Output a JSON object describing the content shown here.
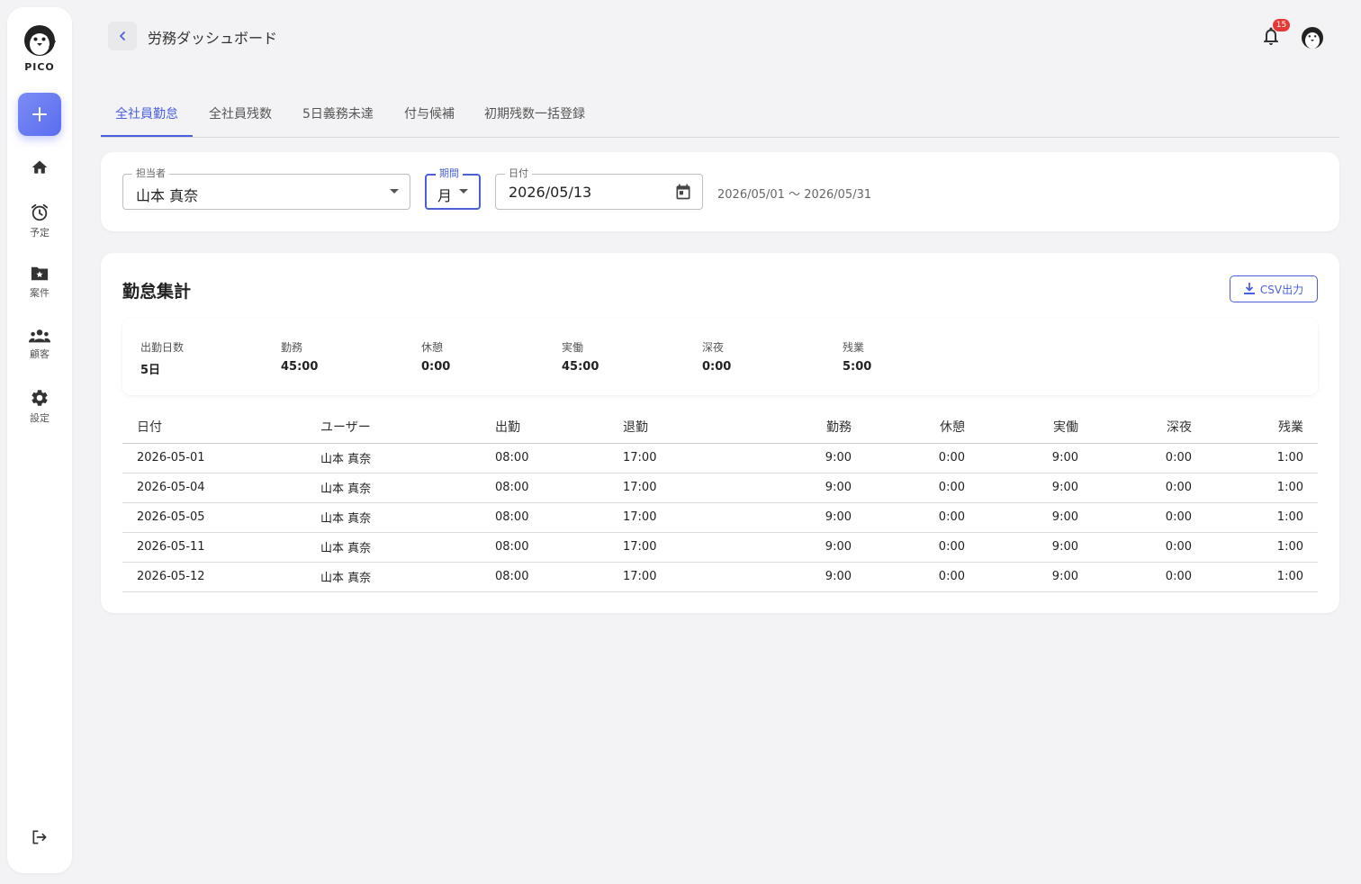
{
  "app": {
    "logo_text": "PICO"
  },
  "sidebar": {
    "items": [
      {
        "label": "",
        "icon": "home-icon"
      },
      {
        "label": "予定",
        "icon": "alarm-icon"
      },
      {
        "label": "案件",
        "icon": "folder-star-icon"
      },
      {
        "label": "顧客",
        "icon": "people-icon"
      },
      {
        "label": "設定",
        "icon": "gear-icon"
      }
    ]
  },
  "header": {
    "title": "労務ダッシュボード",
    "notification_count": "15"
  },
  "tabs": [
    "全社員勤怠",
    "全社員残数",
    "5日義務未達",
    "付与候補",
    "初期残数一括登録"
  ],
  "filters": {
    "assignee": {
      "label": "担当者",
      "value": "山本 真奈"
    },
    "period": {
      "label": "期間",
      "value": "月"
    },
    "date": {
      "label": "日付",
      "value": "2026/05/13"
    },
    "range_text": "2026/05/01 〜 2026/05/31"
  },
  "summary": {
    "title": "勤怠集計",
    "csv_label": "CSV出力",
    "stats": [
      {
        "label": "出勤日数",
        "value": "5日"
      },
      {
        "label": "勤務",
        "value": "45:00"
      },
      {
        "label": "休憩",
        "value": "0:00"
      },
      {
        "label": "実働",
        "value": "45:00"
      },
      {
        "label": "深夜",
        "value": "0:00"
      },
      {
        "label": "残業",
        "value": "5:00"
      }
    ]
  },
  "table": {
    "headers": [
      "日付",
      "ユーザー",
      "出勤",
      "退勤",
      "勤務",
      "休憩",
      "実働",
      "深夜",
      "残業"
    ],
    "rows": [
      [
        "2026-05-01",
        "山本 真奈",
        "08:00",
        "17:00",
        "9:00",
        "0:00",
        "9:00",
        "0:00",
        "1:00"
      ],
      [
        "2026-05-04",
        "山本 真奈",
        "08:00",
        "17:00",
        "9:00",
        "0:00",
        "9:00",
        "0:00",
        "1:00"
      ],
      [
        "2026-05-05",
        "山本 真奈",
        "08:00",
        "17:00",
        "9:00",
        "0:00",
        "9:00",
        "0:00",
        "1:00"
      ],
      [
        "2026-05-11",
        "山本 真奈",
        "08:00",
        "17:00",
        "9:00",
        "0:00",
        "9:00",
        "0:00",
        "1:00"
      ],
      [
        "2026-05-12",
        "山本 真奈",
        "08:00",
        "17:00",
        "9:00",
        "0:00",
        "9:00",
        "0:00",
        "1:00"
      ]
    ]
  },
  "colors": {
    "accent": "#4a5fe0",
    "badge": "#e53935",
    "background": "#f3f3f5"
  }
}
